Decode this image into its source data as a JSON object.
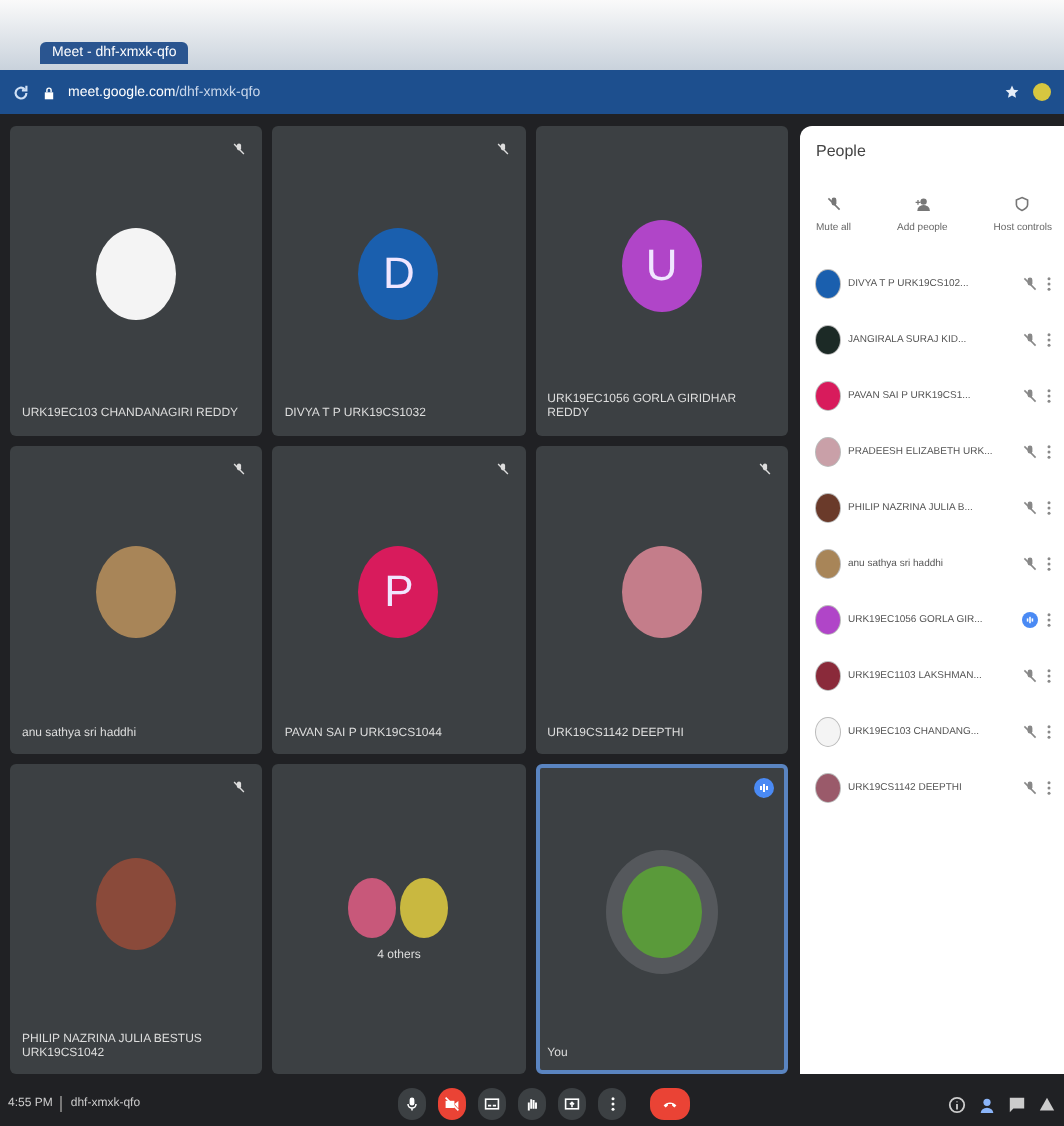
{
  "browser": {
    "tab_title": "Meet - dhf-xmxk-qfo",
    "url_host": "meet.google.com",
    "url_path": "/dhf-xmxk-qfo"
  },
  "tiles": [
    {
      "kind": "photo",
      "name": "URK19EC103 CHANDANAGIRI REDDY",
      "color": "#f4f4f4",
      "muted": true,
      "selected": false
    },
    {
      "kind": "letter",
      "name": "DIVYA T P URK19CS1032",
      "letter": "D",
      "color": "#1a5fae",
      "muted": true,
      "selected": false
    },
    {
      "kind": "letter",
      "name": "URK19EC1056 GORLA GIRIDHAR REDDY",
      "letter": "U",
      "color": "#b045c8",
      "muted": false,
      "selected": false
    },
    {
      "kind": "photo",
      "name": "anu sathya sri haddhi",
      "color": "#a88558",
      "muted": true,
      "selected": false
    },
    {
      "kind": "letter",
      "name": "PAVAN SAI P URK19CS1044",
      "letter": "P",
      "color": "#d81b5c",
      "muted": true,
      "selected": false
    },
    {
      "kind": "photo",
      "name": "URK19CS1142 DEEPTHI",
      "color": "#c47d8a",
      "muted": true,
      "selected": false
    },
    {
      "kind": "photo",
      "name": "PHILIP NAZRINA JULIA BESTUS URK19CS1042",
      "color": "#8a4a3a",
      "muted": true,
      "selected": false
    },
    {
      "kind": "group",
      "name": "4 others",
      "color": "#c9b840",
      "muted": false,
      "selected": false
    },
    {
      "kind": "photo",
      "name": "You",
      "color": "#5a9a3a",
      "muted": false,
      "selected": true
    }
  ],
  "people_panel": {
    "title": "People",
    "actions": [
      {
        "label": "Mute all"
      },
      {
        "label": "Add people"
      },
      {
        "label": "Host controls"
      }
    ],
    "people": [
      {
        "name": "DIVYA T P URK19CS102...",
        "color": "#1a5fae",
        "speaking": false
      },
      {
        "name": "JANGIRALA SURAJ KID...",
        "color": "#1c2a26",
        "speaking": false
      },
      {
        "name": "PAVAN SAI P URK19CS1...",
        "color": "#d81b5c",
        "speaking": false
      },
      {
        "name": "PRADEESH ELIZABETH URK...",
        "color": "#c9a0a8",
        "speaking": false
      },
      {
        "name": "PHILIP NAZRINA JULIA B...",
        "color": "#6a3a2a",
        "speaking": false
      },
      {
        "name": "anu sathya sri haddhi",
        "color": "#a88558",
        "speaking": false
      },
      {
        "name": "URK19EC1056 GORLA GIR...",
        "color": "#b045c8",
        "speaking": true
      },
      {
        "name": "URK19EC1103 LAKSHMAN...",
        "color": "#8a2a3a",
        "speaking": false
      },
      {
        "name": "URK19EC103 CHANDANG...",
        "color": "#f4f4f4",
        "speaking": false
      },
      {
        "name": "URK19CS1142 DEEPTHI",
        "color": "#9a5a6a",
        "speaking": false
      }
    ]
  },
  "bottom_bar": {
    "time": "4:55 PM",
    "meeting_code": "dhf-xmxk-qfo",
    "mic_on": true,
    "camera_on": false
  }
}
